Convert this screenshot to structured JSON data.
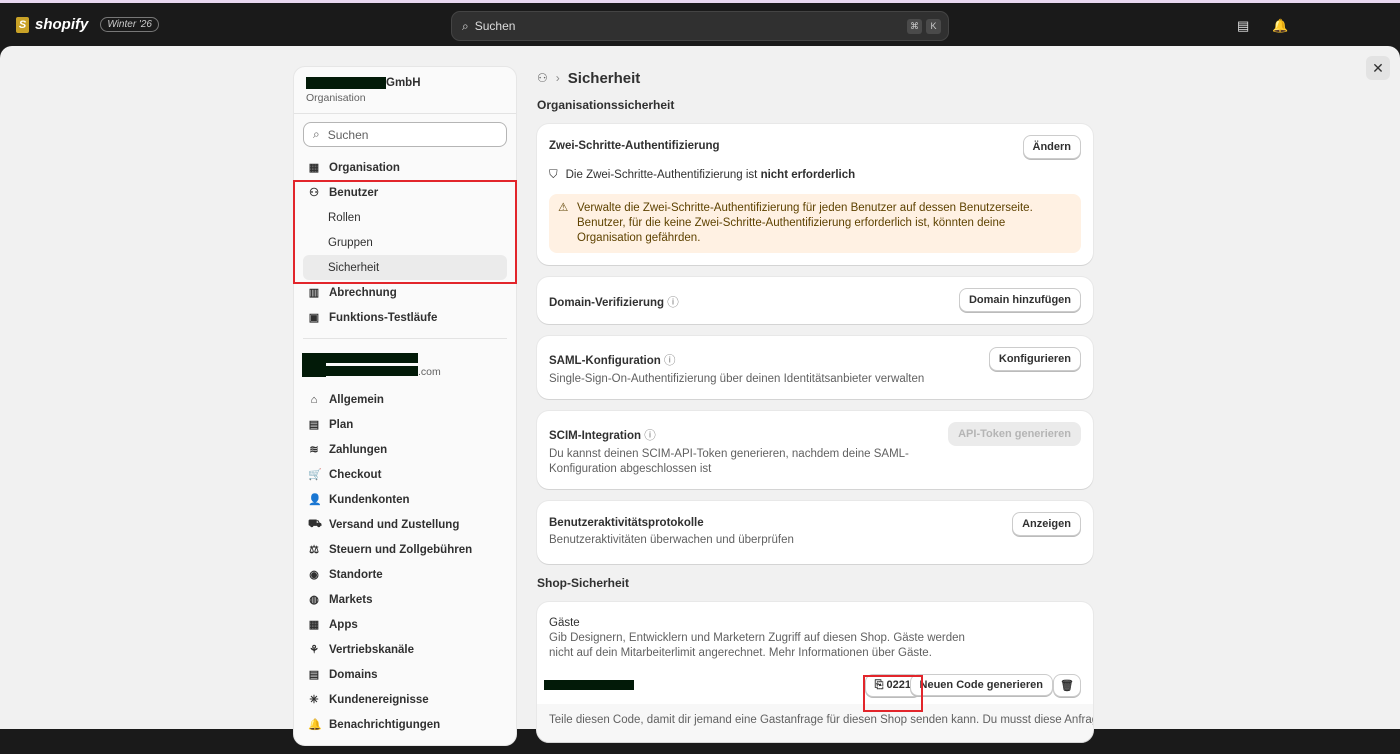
{
  "topbar": {
    "brand": "shopify",
    "edition": "Winter '26",
    "search_placeholder": "Suchen",
    "kbd1": "⌘",
    "kbd2": "K"
  },
  "sidebar": {
    "org_suffix": "GmbH",
    "org_label": "Organisation",
    "search_placeholder": "Suchen",
    "store_suffix": ".com",
    "org_items": [
      {
        "label": "Organisation",
        "icon": "🏢"
      },
      {
        "label": "Benutzer",
        "icon": "👥"
      },
      {
        "label": "Rollen"
      },
      {
        "label": "Gruppen"
      },
      {
        "label": "Sicherheit"
      },
      {
        "label": "Abrechnung",
        "icon": "🧾"
      },
      {
        "label": "Funktions-Testläufe",
        "icon": "📋"
      }
    ],
    "store_items": [
      "Allgemein",
      "Plan",
      "Zahlungen",
      "Checkout",
      "Kundenkonten",
      "Versand und Zustellung",
      "Steuern und Zollgebühren",
      "Standorte",
      "Markets",
      "Apps",
      "Vertriebskanäle",
      "Domains",
      "Kundenereignisse",
      "Benachrichtigungen"
    ]
  },
  "main": {
    "breadcrumb": "Sicherheit",
    "org_section": "Organisationssicherheit",
    "twofa": {
      "title": "Zwei-Schritte-Authentifizierung",
      "button": "Ändern",
      "status_pre": "Die Zwei-Schritte-Authentifizierung ist ",
      "status_bold": "nicht erforderlich",
      "warning": "Verwalte die Zwei-Schritte-Authentifizierung für jeden Benutzer auf dessen Benutzerseite. Benutzer, für die keine Zwei-Schritte-Authentifizierung erforderlich ist, könnten deine Organisation gefährden."
    },
    "domain": {
      "title": "Domain-Verifizierung",
      "button": "Domain hinzufügen"
    },
    "saml": {
      "title": "SAML-Konfiguration",
      "desc": "Single-Sign-On-Authentifizierung über deinen Identitätsanbieter verwalten",
      "button": "Konfigurieren"
    },
    "scim": {
      "title": "SCIM-Integration",
      "desc": "Du kannst deinen SCIM-API-Token generieren, nachdem deine SAML-Konfiguration abgeschlossen ist",
      "button": "API-Token generieren"
    },
    "logs": {
      "title": "Benutzeraktivitätsprotokolle",
      "desc": "Benutzeraktivitäten überwachen und überprüfen",
      "button": "Anzeigen"
    },
    "shop_section": "Shop-Sicherheit",
    "guests": {
      "title": "Gäste",
      "desc": "Gib Designern, Entwicklern und Marketern Zugriff auf diesen Shop. Gäste werden nicht auf dein Mitarbeiterlimit angerechnet. Mehr Informationen über Gäste.",
      "code": "0221",
      "regen": "Neuen Code generieren",
      "footer": "Teile diesen Code, damit dir jemand eine Gastanfrage für diesen Shop senden kann. Du musst diese Anfrage"
    }
  }
}
